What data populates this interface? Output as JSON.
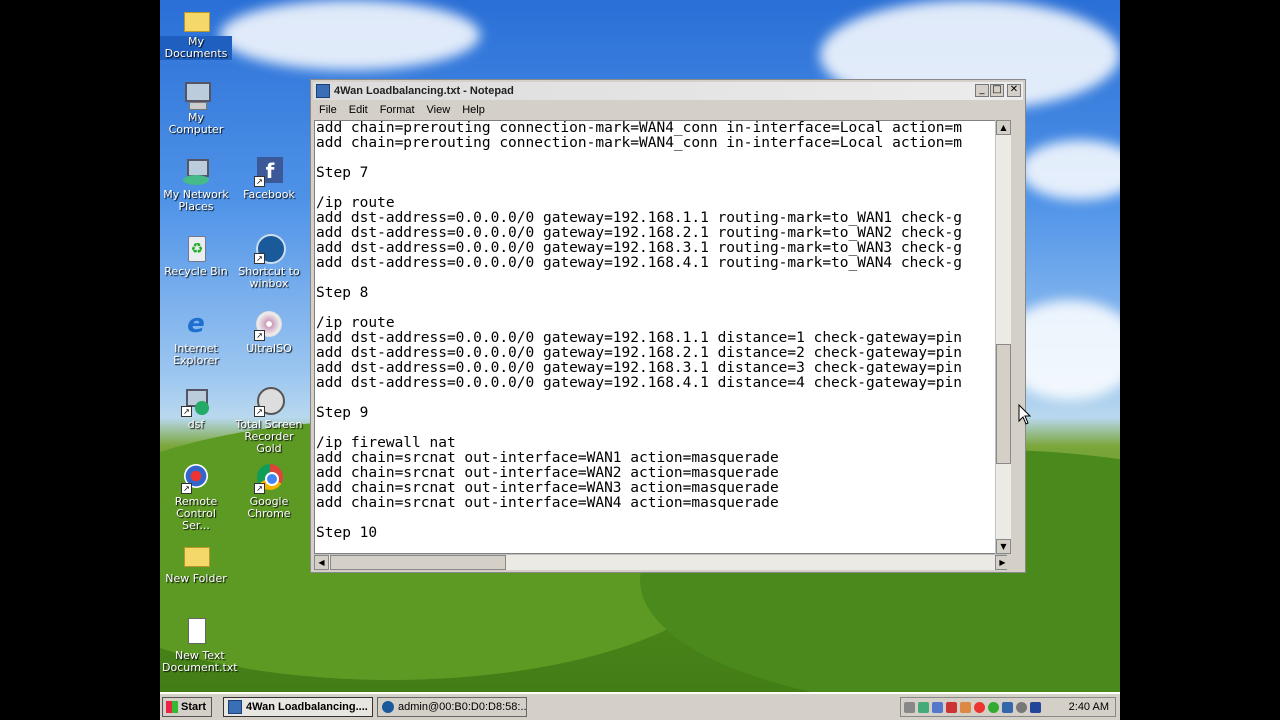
{
  "desktop": {
    "icons": [
      {
        "label": "My Documents",
        "icon": "folder-icon"
      },
      {
        "label": "My Computer",
        "icon": "computer-icon"
      },
      {
        "label": "My Network Places",
        "icon": "network-icon"
      },
      {
        "label": "Facebook",
        "icon": "facebook-icon"
      },
      {
        "label": "Recycle Bin",
        "icon": "recycle-bin-icon"
      },
      {
        "label": "Shortcut to winbox",
        "icon": "winbox-icon"
      },
      {
        "label": "Internet Explorer",
        "icon": "ie-icon"
      },
      {
        "label": "UltraISO",
        "icon": "disc-icon"
      },
      {
        "label": "dsf",
        "icon": "network-shortcut-icon"
      },
      {
        "label": "Total Screen Recorder Gold",
        "icon": "film-reel-icon"
      },
      {
        "label": "Remote Control Ser...",
        "icon": "remote-control-icon"
      },
      {
        "label": "Google Chrome",
        "icon": "chrome-icon"
      },
      {
        "label": "New Folder",
        "icon": "folder-icon"
      },
      {
        "label": "New Text Document.txt",
        "icon": "text-document-icon"
      }
    ]
  },
  "notepad": {
    "title": "4Wan Loadbalancing.txt - Notepad",
    "menu": [
      "File",
      "Edit",
      "Format",
      "View",
      "Help"
    ],
    "lines": [
      "add chain=prerouting connection-mark=WAN4_conn in-interface=Local action=m",
      "add chain=prerouting connection-mark=WAN4_conn in-interface=Local action=m",
      "",
      "Step 7",
      "",
      "/ip route",
      "add dst-address=0.0.0.0/0 gateway=192.168.1.1 routing-mark=to_WAN1 check-g",
      "add dst-address=0.0.0.0/0 gateway=192.168.2.1 routing-mark=to_WAN2 check-g",
      "add dst-address=0.0.0.0/0 gateway=192.168.3.1 routing-mark=to_WAN3 check-g",
      "add dst-address=0.0.0.0/0 gateway=192.168.4.1 routing-mark=to_WAN4 check-g",
      "",
      "Step 8",
      "",
      "/ip route",
      "add dst-address=0.0.0.0/0 gateway=192.168.1.1 distance=1 check-gateway=pin",
      "add dst-address=0.0.0.0/0 gateway=192.168.2.1 distance=2 check-gateway=pin",
      "add dst-address=0.0.0.0/0 gateway=192.168.3.1 distance=3 check-gateway=pin",
      "add dst-address=0.0.0.0/0 gateway=192.168.4.1 distance=4 check-gateway=pin",
      "",
      "Step 9",
      "",
      "/ip firewall nat",
      "add chain=srcnat out-interface=WAN1 action=masquerade",
      "add chain=srcnat out-interface=WAN2 action=masquerade",
      "add chain=srcnat out-interface=WAN3 action=masquerade",
      "add chain=srcnat out-interface=WAN4 action=masquerade",
      "",
      "Step 10"
    ]
  },
  "taskbar": {
    "start_label": "Start",
    "tasks": [
      {
        "label": "4Wan Loadbalancing....",
        "active": true
      },
      {
        "label": "admin@00:B0:D0:D8:58:...",
        "active": false
      }
    ],
    "clock": "2:40 AM"
  },
  "colors": {
    "sky": "#3a7fdd",
    "grass": "#4f8a1e",
    "icon_label_highlight": "#1f5fbf",
    "window_frame": "#d4d0c8"
  }
}
